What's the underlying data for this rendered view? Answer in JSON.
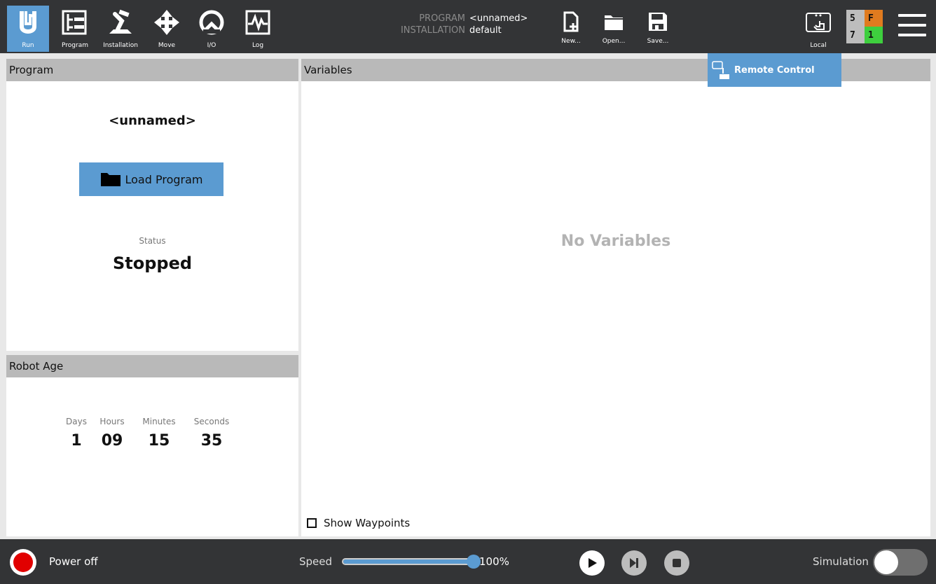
{
  "nav": {
    "run": "Run",
    "program": "Program",
    "installation": "Installation",
    "move": "Move",
    "io": "I/O",
    "log": "Log"
  },
  "program_info": {
    "program_key": "PROGRAM",
    "program_value": "<unnamed>",
    "installation_key": "INSTALLATION",
    "installation_value": "default"
  },
  "file_buttons": {
    "new": "New...",
    "open": "Open...",
    "save": "Save..."
  },
  "control_mode": {
    "label": "Local",
    "remote_option": "Remote Control"
  },
  "status_grid": {
    "top_left": "5",
    "top_right": "F",
    "bottom_left": "7",
    "bottom_right": "1",
    "colors": {
      "neutral": "#bdbdbd",
      "fault": "#e07b1f",
      "ok": "#3ecf3e"
    }
  },
  "program_panel": {
    "header": "Program",
    "program_name": "<unnamed>",
    "load_button": "Load Program",
    "status_label": "Status",
    "status_value": "Stopped"
  },
  "robot_age": {
    "header": "Robot Age",
    "labels": [
      "Days",
      "Hours",
      "Minutes",
      "Seconds"
    ],
    "values": [
      "1",
      "09",
      "15",
      "35"
    ]
  },
  "variables": {
    "header": "Variables",
    "empty_text": "No Variables",
    "show_waypoints": "Show Waypoints"
  },
  "bottom": {
    "power_label": "Power off",
    "speed_label": "Speed",
    "speed_value": "100%",
    "speed_fraction": 1.0,
    "simulation_label": "Simulation"
  },
  "colors": {
    "accent": "#5b9bd1",
    "bar": "#333436",
    "power_red": "#e10000"
  }
}
